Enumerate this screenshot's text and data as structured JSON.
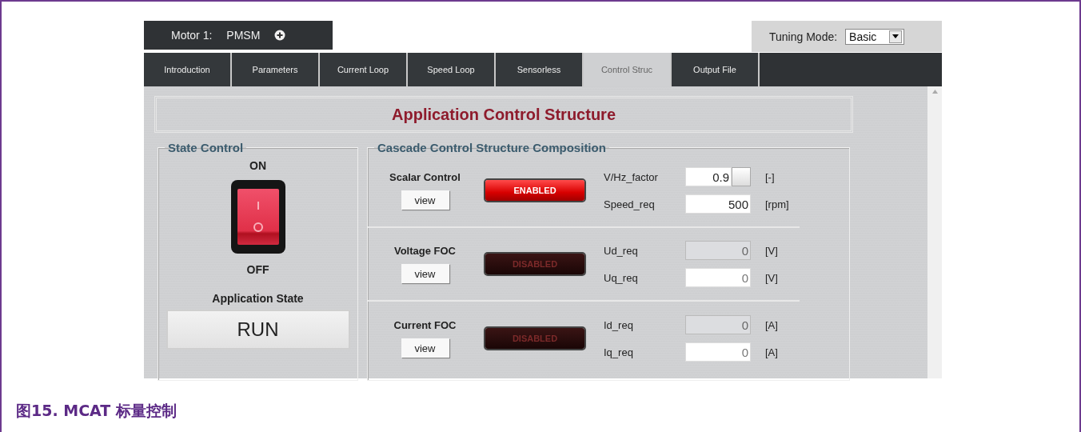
{
  "header": {
    "motor_label": "Motor 1:",
    "motor_type": "PMSM",
    "tuning_mode_label": "Tuning Mode:",
    "tuning_mode": "Basic"
  },
  "tabs": [
    {
      "label": "Introduction",
      "selected": false
    },
    {
      "label": "Parameters",
      "selected": false
    },
    {
      "label": "Current Loop",
      "selected": false
    },
    {
      "label": "Speed Loop",
      "selected": false
    },
    {
      "label": "Sensorless",
      "selected": false
    },
    {
      "label": "Control Struc",
      "selected": true
    },
    {
      "label": "Output File",
      "selected": false
    }
  ],
  "page_title": "Application Control Structure",
  "state_control": {
    "title": "State Control",
    "on_label": "ON",
    "off_label": "OFF",
    "switch_on": true,
    "app_state_label": "Application State",
    "app_state": "RUN"
  },
  "cascade": {
    "title": "Cascade Control Structure Composition",
    "sections": [
      {
        "name": "Scalar Control",
        "view": "view",
        "status": "ENABLED",
        "enabled": true,
        "params": [
          {
            "label": "V/Hz_factor",
            "value": "0.9",
            "unit": "[-]",
            "kind": "stepper",
            "disabled": false
          },
          {
            "label": "Speed_req",
            "value": "500",
            "unit": "[rpm]",
            "kind": "plain",
            "disabled": false
          }
        ]
      },
      {
        "name": "Voltage FOC",
        "view": "view",
        "status": "DISABLED",
        "enabled": false,
        "params": [
          {
            "label": "Ud_req",
            "value": "0",
            "unit": "[V]",
            "kind": "plain",
            "disabled": true
          },
          {
            "label": "Uq_req",
            "value": "0",
            "unit": "[V]",
            "kind": "plain",
            "disabled": false
          }
        ]
      },
      {
        "name": "Current FOC",
        "view": "view",
        "status": "DISABLED",
        "enabled": false,
        "params": [
          {
            "label": "Id_req",
            "value": "0",
            "unit": "[A]",
            "kind": "plain",
            "disabled": true
          },
          {
            "label": "Iq_req",
            "value": "0",
            "unit": "[A]",
            "kind": "plain",
            "disabled": false
          }
        ]
      }
    ]
  },
  "caption": "图15. MCAT 标量控制"
}
